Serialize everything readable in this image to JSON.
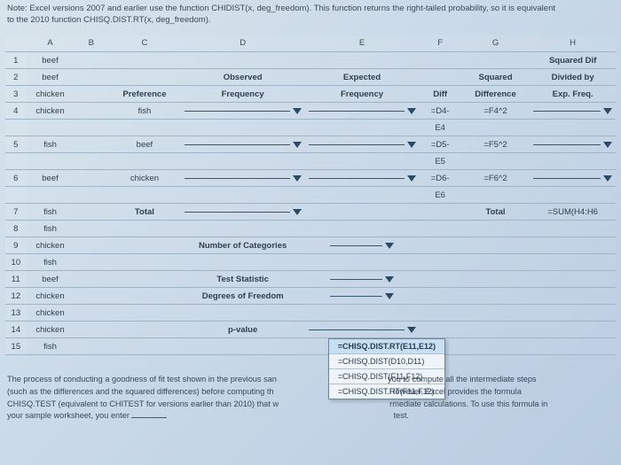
{
  "note": {
    "line1": "Note: Excel versions 2007 and earlier use the function CHIDIST(x, deg_freedom). This function returns the right-tailed probability, so it is equivalent",
    "line2": "to the 2010 function CHISQ.DIST.RT(x, deg_freedom)."
  },
  "cols": {
    "A": "A",
    "B": "B",
    "C": "C",
    "D": "D",
    "E": "E",
    "F": "F",
    "G": "G",
    "H": "H"
  },
  "rows": {
    "r1": "1",
    "r2": "2",
    "r3": "3",
    "r4": "4",
    "r5": "5",
    "r6": "6",
    "r7": "7",
    "r8": "8",
    "r9": "9",
    "r10": "10",
    "r11": "11",
    "r12": "12",
    "r13": "13",
    "r14": "14",
    "r15": "15"
  },
  "a": {
    "a1": "beef",
    "a2": "beef",
    "a3": "chicken",
    "a4": "chicken",
    "a5": "fish",
    "a6": "beef",
    "a7": "fish",
    "a8": "fish",
    "a9": "chicken",
    "a10": "fish",
    "a11": "beef",
    "a12": "chicken",
    "a13": "chicken",
    "a14": "chicken",
    "a15": "fish"
  },
  "c": {
    "c3": "Preference",
    "c4": "fish",
    "c5": "beef",
    "c6": "chicken",
    "c7": "Total"
  },
  "d": {
    "d2": "Observed",
    "d3": "Frequency",
    "d9": "Number of Categories",
    "d11": "Test Statistic",
    "d12": "Degrees of Freedom",
    "d14": "p-value"
  },
  "e": {
    "e2": "Expected",
    "e3": "Frequency"
  },
  "f": {
    "f3": "Diff",
    "f4a": "=D4-",
    "f4b": "E4",
    "f5a": "=D5-",
    "f5b": "E5",
    "f6a": "=D6-",
    "f6b": "E6"
  },
  "g": {
    "g2": "Squared",
    "g3": "Difference",
    "g4": "=F4^2",
    "g5": "=F5^2",
    "g6": "=F6^2",
    "g7": "Total"
  },
  "h": {
    "h1": "Squared Dif",
    "h2": "Divided by",
    "h3": "Exp. Freq.",
    "h7": "=SUM(H4:H6"
  },
  "dropdown_options": {
    "o1": "=CHISQ.DIST.RT(E11,E12)",
    "o2": "=CHISQ.DIST(D10,D11)",
    "o3": "=CHISQ.DIST(F11,F12)",
    "o4": "=CHISQ.DIST.RT(F11,F12)"
  },
  "footer": {
    "p1a": "The process of conducting a goodness of fit test shown in the previous san",
    "p1b": "you to compute all the intermediate steps",
    "p2a": "(such as the differences and the squared differences) before computing th",
    "p2b": ". However, Excel provides the formula",
    "p3a": "CHISQ.TEST (equivalent to CHITEST for versions earlier than 2010) that w",
    "p3b": "rmediate calculations. To use this formula in",
    "p4a": "your sample worksheet, you enter ",
    "p4b": " test."
  }
}
